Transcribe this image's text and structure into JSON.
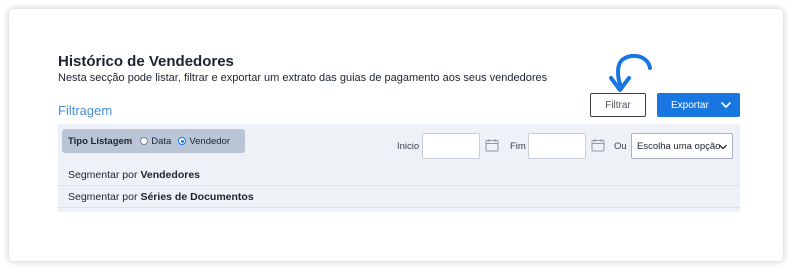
{
  "header": {
    "title": "Histórico de Vendedores",
    "subtitle": "Nesta secção pode listar, filtrar e exportar um extrato das guias de pagamento aos seus vendedores"
  },
  "filter_section": {
    "title": "Filtragem"
  },
  "toolbar": {
    "filter_label": "Filtrar",
    "export_label": "Exportar"
  },
  "list_type": {
    "label": "Tipo Listagem",
    "options": [
      "Data",
      "Vendedor"
    ],
    "selected": "Vendedor"
  },
  "dates": {
    "start_label": "Inicio",
    "end_label": "Fim",
    "or_label": "Ou",
    "start_value": "",
    "end_value": ""
  },
  "preset_select": {
    "selected": "Escolha uma opção"
  },
  "segments": [
    {
      "prefix": "Segmentar por",
      "target": "Vendedores"
    },
    {
      "prefix": "Segmentar por",
      "target": "Séries de Documentos"
    }
  ],
  "colors": {
    "accent": "#1876e0",
    "link": "#4a90d9",
    "panel": "#eef1f6",
    "tipo_box": "#b9c5d6"
  },
  "icons": [
    "arrow-pointer-icon",
    "chevron-down-icon",
    "calendar-icon"
  ]
}
